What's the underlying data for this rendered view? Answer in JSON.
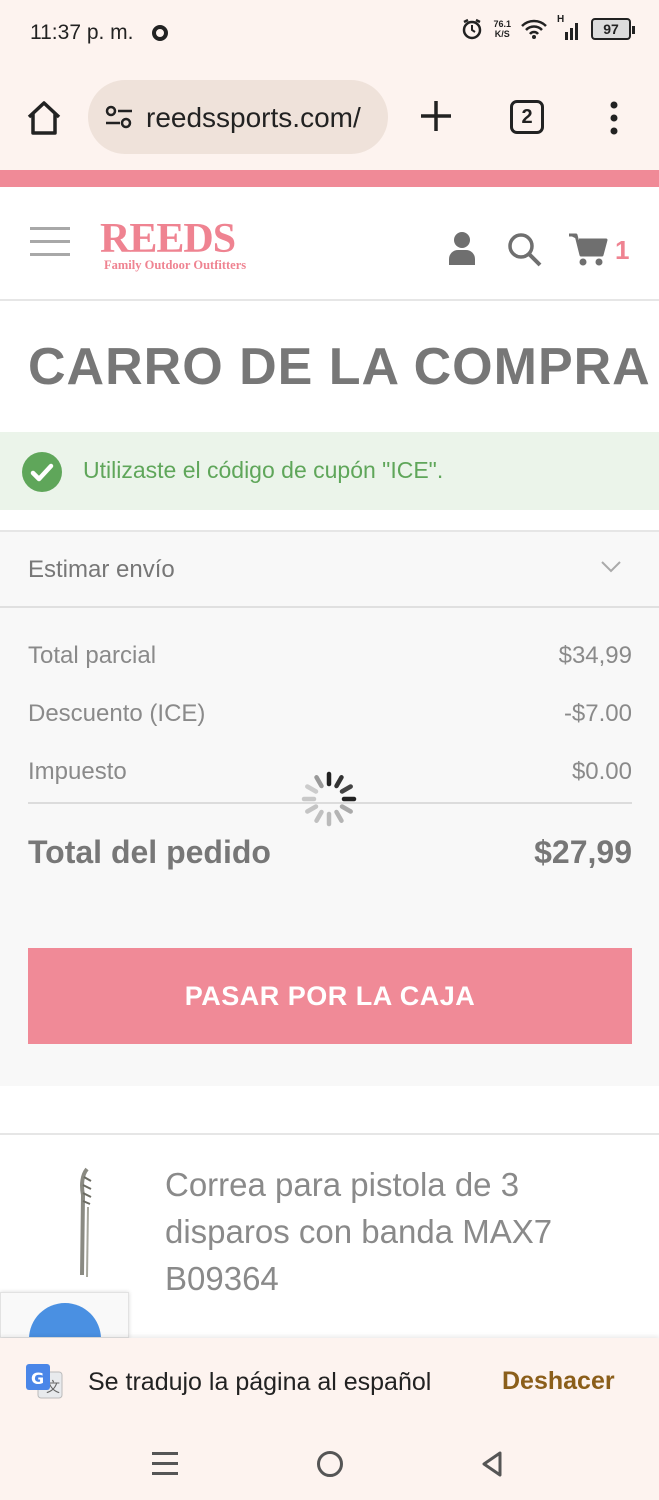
{
  "status_bar": {
    "time": "11:37 p. m.",
    "net_speed_value": "76.1",
    "net_speed_unit": "K/S",
    "signal_label": "H",
    "battery": "97"
  },
  "browser": {
    "url": "reedssports.com/",
    "tab_count": "2"
  },
  "site": {
    "logo_main": "REEDS",
    "logo_sub": "Family Outdoor Outfitters",
    "cart_count": "1",
    "brand_color": "#f08a97"
  },
  "page": {
    "title": "CARRO DE LA COMPRA",
    "success_message": "Utilizaste el código de cupón \"ICE\"."
  },
  "summary": {
    "estimate_label": "Estimar envío",
    "rows": [
      {
        "label": "Total parcial",
        "value": "$34,99"
      },
      {
        "label": "Descuento (ICE)",
        "value": "-$7.00"
      },
      {
        "label": "Impuesto",
        "value": "$0.00"
      }
    ],
    "total_label": "Total del pedido",
    "total_value": "$27,99",
    "checkout_label": "PASAR POR LA CAJA"
  },
  "product": {
    "name": "Correa para pistola de 3 disparos con banda MAX7 B09364"
  },
  "translate": {
    "message": "Se tradujo la página al español",
    "undo_label": "Deshacer"
  }
}
